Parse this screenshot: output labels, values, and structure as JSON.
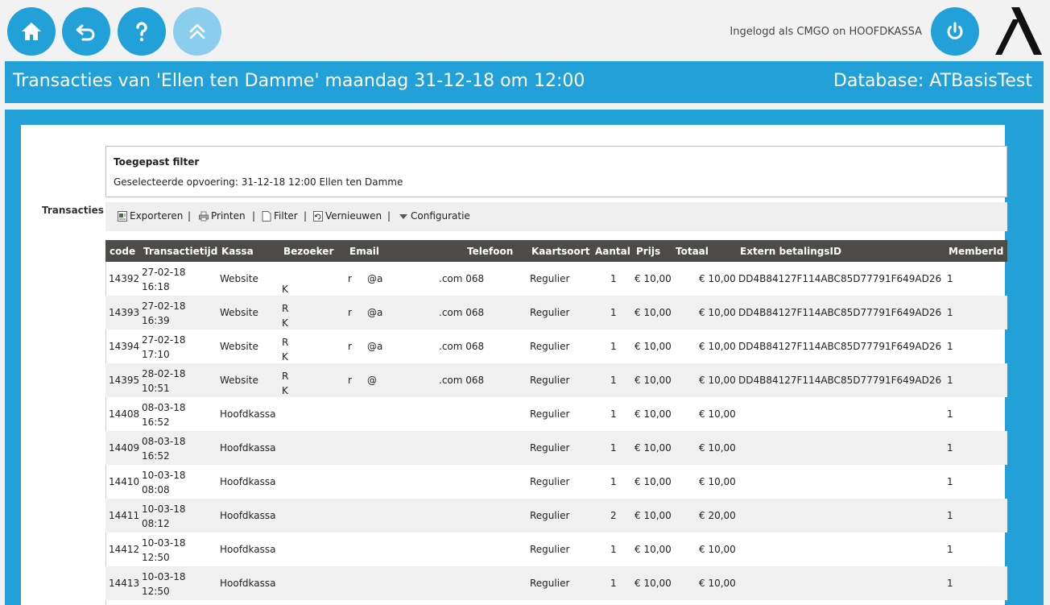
{
  "topbar": {
    "icons": [
      "home-icon",
      "undo-icon",
      "help-icon",
      "chevrons-up-icon",
      "power-icon"
    ],
    "login_text": "Ingelogd als CMGO on HOOFDKASSA",
    "accent": "#22a1d8"
  },
  "titlebar": {
    "title": "Transacties van 'Ellen ten Damme' maandag 31-12-18 om 12:00",
    "database": "Database: ATBasisTest"
  },
  "section_label": "Transacties",
  "filter": {
    "title": "Toegepast filter",
    "line": "Geselecteerde opvoering:  31-12-18 12:00 Ellen ten Damme"
  },
  "toolbar": {
    "export": "Exporteren",
    "print": "Printen",
    "filter": "Filter",
    "refresh": "Vernieuwen",
    "config": "Configuratie",
    "sep": "|"
  },
  "table": {
    "header_bg": "#4d4b47",
    "columns": [
      "code",
      "Transactietijd",
      "Kassa",
      "Bezoeker",
      "Email",
      "Telefoon",
      "Kaartsoort",
      "Aantal",
      "Prijs",
      "Totaal",
      "Extern betalingsID",
      "MemberId"
    ],
    "rows": [
      {
        "code": "14392",
        "date": "27-02-18",
        "time": "16:18",
        "kassa": "Website",
        "bez1": "",
        "bez2": "K",
        "email1": "r",
        "email2": "@a",
        "tel": ".com 068",
        "ks": "Regulier",
        "aantal": "1",
        "prijs": "€ 10,00",
        "totaal": "€ 10,00",
        "extern": "DD4B84127F114ABC85D77791F649AD26",
        "member": "1"
      },
      {
        "code": "14393",
        "date": "27-02-18",
        "time": "16:39",
        "kassa": "Website",
        "bez1": "R",
        "bez2": "K",
        "email1": "r",
        "email2": "@a",
        "tel": ".com 068",
        "ks": "Regulier",
        "aantal": "1",
        "prijs": "€ 10,00",
        "totaal": "€ 10,00",
        "extern": "DD4B84127F114ABC85D77791F649AD26",
        "member": "1"
      },
      {
        "code": "14394",
        "date": "27-02-18",
        "time": "17:10",
        "kassa": "Website",
        "bez1": "R",
        "bez2": "K",
        "email1": "r",
        "email2": "@a",
        "tel": ".com 068",
        "ks": "Regulier",
        "aantal": "1",
        "prijs": "€ 10,00",
        "totaal": "€ 10,00",
        "extern": "DD4B84127F114ABC85D77791F649AD26",
        "member": "1"
      },
      {
        "code": "14395",
        "date": "28-02-18",
        "time": "10:51",
        "kassa": "Website",
        "bez1": "R",
        "bez2": "K",
        "email1": "r",
        "email2": "@",
        "tel": ".com 068",
        "ks": "Regulier",
        "aantal": "1",
        "prijs": "€ 10,00",
        "totaal": "€ 10,00",
        "extern": "DD4B84127F114ABC85D77791F649AD26",
        "member": "1"
      },
      {
        "code": "14408",
        "date": "08-03-18",
        "time": "16:52",
        "kassa": "Hoofdkassa",
        "bez1": "",
        "bez2": "",
        "email1": "",
        "email2": "",
        "tel": "",
        "ks": "Regulier",
        "aantal": "1",
        "prijs": "€ 10,00",
        "totaal": "€ 10,00",
        "extern": "",
        "member": "1"
      },
      {
        "code": "14409",
        "date": "08-03-18",
        "time": "16:52",
        "kassa": "Hoofdkassa",
        "bez1": "",
        "bez2": "",
        "email1": "",
        "email2": "",
        "tel": "",
        "ks": "Regulier",
        "aantal": "1",
        "prijs": "€ 10,00",
        "totaal": "€ 10,00",
        "extern": "",
        "member": "1"
      },
      {
        "code": "14410",
        "date": "10-03-18",
        "time": "08:08",
        "kassa": "Hoofdkassa",
        "bez1": "",
        "bez2": "",
        "email1": "",
        "email2": "",
        "tel": "",
        "ks": "Regulier",
        "aantal": "1",
        "prijs": "€ 10,00",
        "totaal": "€ 10,00",
        "extern": "",
        "member": "1"
      },
      {
        "code": "14411",
        "date": "10-03-18",
        "time": "08:12",
        "kassa": "Hoofdkassa",
        "bez1": "",
        "bez2": "",
        "email1": "",
        "email2": "",
        "tel": "",
        "ks": "Regulier",
        "aantal": "2",
        "prijs": "€ 10,00",
        "totaal": "€ 20,00",
        "extern": "",
        "member": "1"
      },
      {
        "code": "14412",
        "date": "10-03-18",
        "time": "12:50",
        "kassa": "Hoofdkassa",
        "bez1": "",
        "bez2": "",
        "email1": "",
        "email2": "",
        "tel": "",
        "ks": "Regulier",
        "aantal": "1",
        "prijs": "€ 10,00",
        "totaal": "€ 10,00",
        "extern": "",
        "member": "1"
      },
      {
        "code": "14413",
        "date": "10-03-18",
        "time": "12:50",
        "kassa": "Hoofdkassa",
        "bez1": "",
        "bez2": "",
        "email1": "",
        "email2": "",
        "tel": "",
        "ks": "Regulier",
        "aantal": "1",
        "prijs": "€ 10,00",
        "totaal": "€ 10,00",
        "extern": "",
        "member": "1"
      }
    ]
  }
}
